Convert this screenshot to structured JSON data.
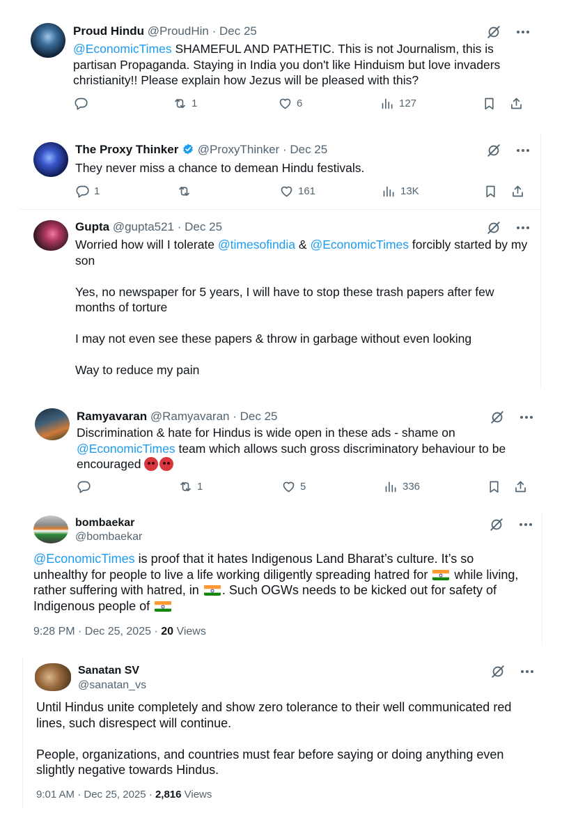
{
  "tweets": [
    {
      "name": "Proud Hindu",
      "handle": "@ProudHin",
      "dot": "·",
      "date": "Dec 25",
      "link": "@EconomicTimes",
      "text": "SHAMEFUL AND PATHETIC. This is not Journalism, this is partisan Propaganda. Staying in India you don't like Hinduism but love invaders christianity!! Please explain how Jezus will be pleased with this?",
      "replies": "",
      "reposts": "1",
      "likes": "6",
      "views": "127"
    },
    {
      "name": "The Proxy Thinker",
      "handle": "@ProxyThinker",
      "dot": "·",
      "date": "Dec 25",
      "text": "They never miss a chance to demean Hindu festivals.",
      "replies": "1",
      "reposts": "",
      "likes": "161",
      "views": "13K"
    },
    {
      "name": "Gupta",
      "handle": "@gupta521",
      "dot": "·",
      "date": "Dec 25",
      "p1_a": "Worried how will I tolerate ",
      "link1": "@timesofindia",
      "p1_b": " & ",
      "link2": "@EconomicTimes",
      "p1_c": " forcibly started by my son",
      "p2": "Yes, no newspaper for 5 years, I will have to stop these trash papers after few months of torture",
      "p3": "I may not even see these papers & throw in garbage without even looking",
      "p4": "Way to reduce my pain"
    },
    {
      "name": "Ramyavaran",
      "handle": "@Ramyavaran",
      "dot": "·",
      "date": "Dec 25",
      "text_a": "Discrimination & hate for Hindus is wide open in these ads - shame on ",
      "link": "@EconomicTimes",
      "text_b": " team which allows such gross discriminatory behaviour to be encouraged",
      "emoji": "angry-face",
      "replies": "",
      "reposts": "1",
      "likes": "5",
      "views": "336"
    },
    {
      "name": "bombaekar",
      "handle": "@bombaekar",
      "link": "@EconomicTimes",
      "t1": " is proof that it hates Indigenous Land Bharat’s culture. It’s so unhealthy for people to live a life working diligently spreading hatred for ",
      "t2": " while living, rather suffering with hatred, in ",
      "t3": ". Such OGWs needs to be kicked out for safety of Indigenous people of ",
      "flag": "india-flag",
      "time": "9:28 PM · Dec 25, 2025 · ",
      "views_count": "20",
      "views_label": " Views"
    },
    {
      "name": "Sanatan SV",
      "handle": "@sanatan_vs",
      "p1": "Until Hindus unite completely and show zero tolerance to their well communicated red lines, such disrespect will continue.",
      "p2": "People, organizations, and countries must fear before saying or doing anything even slightly negative towards Hindus.",
      "time": "9:01 AM · Dec 25, 2025 · ",
      "views_count": "2,816",
      "views_label": " Views"
    }
  ],
  "icons": {
    "reply": "reply-icon",
    "repost": "repost-icon",
    "like": "like-icon",
    "views": "views-icon",
    "bookmark": "bookmark-icon",
    "share": "share-icon",
    "grok": "grok-icon",
    "more": "more-icon",
    "verified": "verified-badge-icon"
  },
  "colors": {
    "link": "#1d9bf0",
    "text": "#0f1419",
    "muted": "#536471",
    "verified": "#1d9bf0"
  }
}
